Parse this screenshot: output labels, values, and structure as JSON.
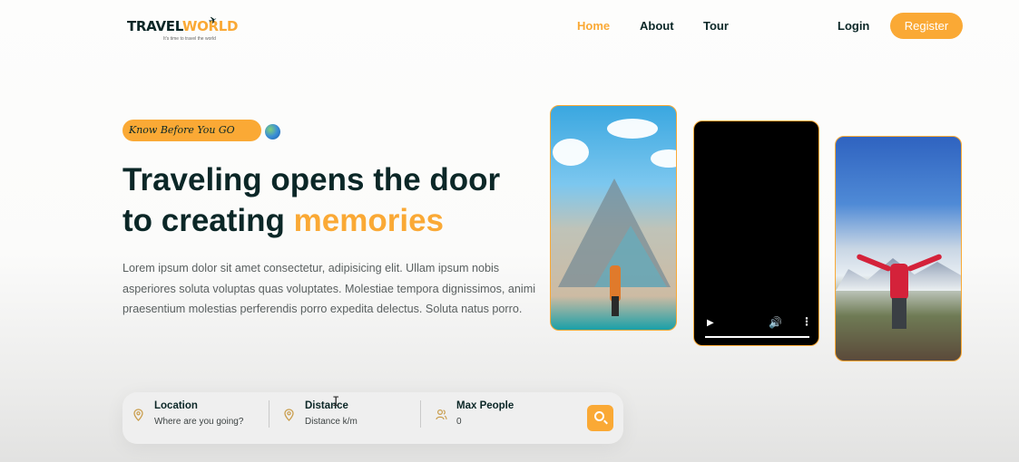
{
  "header": {
    "logo": {
      "travel": "TRAVEL",
      "world": "WORLD",
      "tagline": "It's time to travel the world"
    },
    "nav": [
      {
        "label": "Home"
      },
      {
        "label": "About"
      },
      {
        "label": "Tour"
      }
    ],
    "login_label": "Login",
    "register_label": "Register"
  },
  "hero": {
    "badge": "Know Before You GO",
    "title_line1": "Traveling opens the door",
    "title_line2_prefix": "to creating ",
    "title_highlight": "memories",
    "description": "Lorem ipsum dolor sit amet consectetur, adipisicing elit. Ullam ipsum nobis asperiores soluta voluptas quas voluptates. Molestiae tempora dignissimos, animi praesentium molestias perferendis porro expedita delectus. Soluta natus porro."
  },
  "search": {
    "fields": [
      {
        "label": "Location",
        "value": "Where are you going?",
        "icon": "map-pin-icon"
      },
      {
        "label": "Distance",
        "value": "Distance k/m",
        "icon": "map-pin-icon"
      },
      {
        "label": "Max People",
        "value": "0",
        "icon": "group-icon"
      }
    ],
    "button_icon": "search-icon"
  },
  "colors": {
    "accent": "#faa935",
    "heading": "#0b2727",
    "text": "#5a6060"
  }
}
